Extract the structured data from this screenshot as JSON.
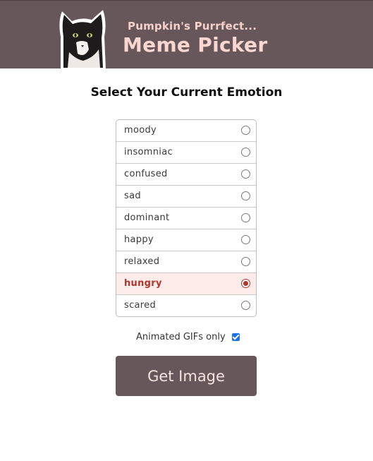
{
  "header": {
    "kicker": "Pumpkin's Purrfect...",
    "title": "Meme Picker"
  },
  "heading": "Select Your Current Emotion",
  "emotions": [
    {
      "label": "moody",
      "selected": false
    },
    {
      "label": "insomniac",
      "selected": false
    },
    {
      "label": "confused",
      "selected": false
    },
    {
      "label": "sad",
      "selected": false
    },
    {
      "label": "dominant",
      "selected": false
    },
    {
      "label": "happy",
      "selected": false
    },
    {
      "label": "relaxed",
      "selected": false
    },
    {
      "label": "hungry",
      "selected": true
    },
    {
      "label": "scared",
      "selected": false
    }
  ],
  "gif_option": {
    "label": "Animated GIFs only",
    "checked": true
  },
  "button_label": "Get Image",
  "colors": {
    "header_bg": "#67575b",
    "accent": "#b0362c",
    "checkbox": "#1a73e8"
  }
}
